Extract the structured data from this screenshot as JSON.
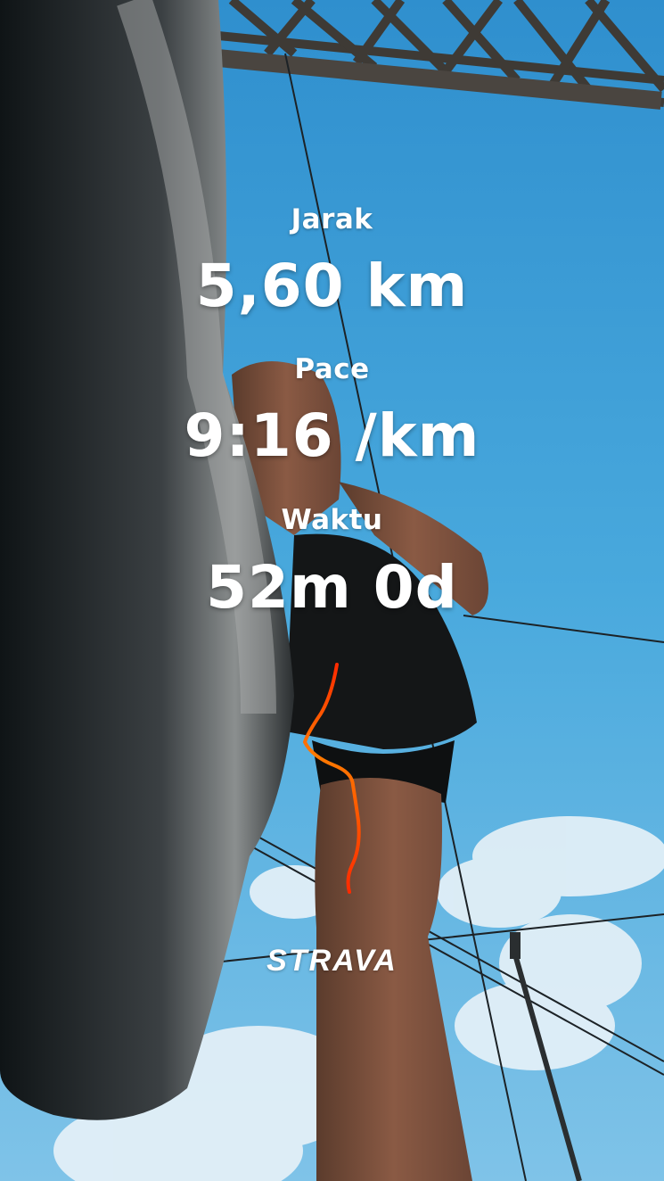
{
  "stats": {
    "distance": {
      "label": "Jarak",
      "value": "5,60 km"
    },
    "pace": {
      "label": "Pace",
      "value": "9:16 /km"
    },
    "time": {
      "label": "Waktu",
      "value": "52m 0d"
    }
  },
  "brand": {
    "logo_text": "STRAVA"
  },
  "colors": {
    "sky": "#3a9fd6",
    "text": "#ffffff",
    "route_start": "#ff7a00",
    "route_end": "#ff2a00"
  }
}
